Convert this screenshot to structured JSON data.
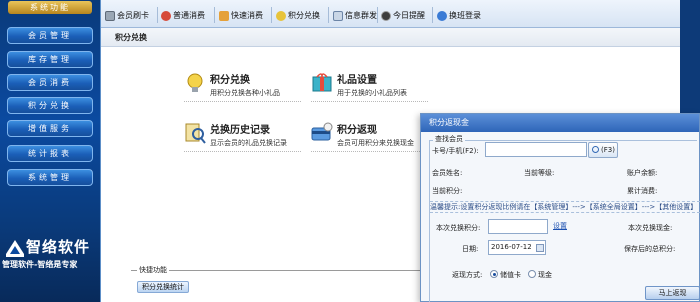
{
  "sidebar": {
    "title": "系统功能",
    "items": [
      {
        "label": "会员管理"
      },
      {
        "label": "库存管理"
      },
      {
        "label": "会员消费"
      },
      {
        "label": "积分兑换"
      },
      {
        "label": "增值服务"
      },
      {
        "label": "统计报表"
      },
      {
        "label": "系统管理"
      }
    ],
    "logo_text": "智络软件",
    "slogan": "管理软件-智络是专家"
  },
  "toolbar": {
    "items": [
      {
        "label": "会员刷卡",
        "icon": "card-icon"
      },
      {
        "label": "普通消费",
        "icon": "cup-icon"
      },
      {
        "label": "快速消费",
        "icon": "hand-icon"
      },
      {
        "label": "积分兑换",
        "icon": "gift-icon"
      },
      {
        "label": "信息群发",
        "icon": "message-icon"
      },
      {
        "label": "今日提醒",
        "icon": "clock-icon"
      },
      {
        "label": "换班登录",
        "icon": "switch-user-icon"
      }
    ]
  },
  "breadcrumb": "积分兑换",
  "features": [
    {
      "title": "积分兑换",
      "desc": "用积分兑换各种小礼品"
    },
    {
      "title": "礼品设置",
      "desc": "用于兑换的小礼品列表"
    },
    {
      "title": "兑换历史记录",
      "desc": "显示会员的礼品兑换记录"
    },
    {
      "title": "积分返现",
      "desc": "会员可用积分来兑换现金"
    }
  ],
  "quick": {
    "label": "快捷功能",
    "button": "积分兑换统计"
  },
  "dialog": {
    "title": "积分返现金",
    "search_group": "查找会员",
    "card_label": "卡号/手机(F2):",
    "card_value": "",
    "lookup_label": "(F3)",
    "member_name_label": "会员姓名:",
    "level_label": "当前等级:",
    "balance_label": "账户余额:",
    "points_label": "当前积分:",
    "total_spent_label": "累计消费:",
    "hint": "温馨提示:设置积分返现比例请在【系统管理】--->【系统全局设置】--->【其他设置】",
    "redeem_points_label": "本次兑换积分:",
    "redeem_points_value": "",
    "settings_link": "设置",
    "redeem_cash_label": "本次兑换现金:",
    "date_label": "日期:",
    "date_value": "2016-07-12",
    "points_after_label": "保存后的总积分:",
    "method_label": "返现方式:",
    "method_options": [
      "储值卡",
      "现金"
    ],
    "method_selected": "储值卡",
    "ok_button": "马上返现"
  }
}
